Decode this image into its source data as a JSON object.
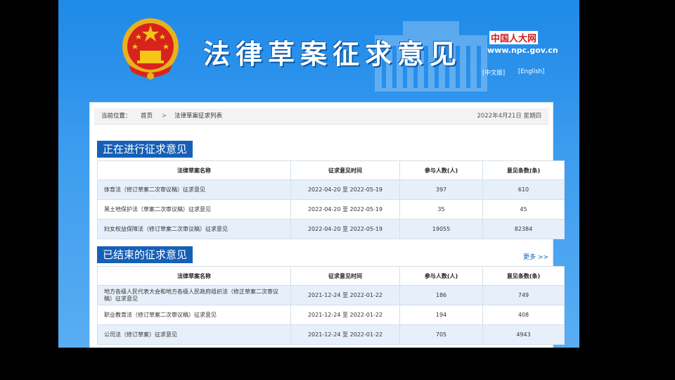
{
  "header": {
    "title": "法律草案征求意见",
    "logo_text": "中国人大网",
    "url": "www.npc.gov.cn",
    "lang_cn": "[中文版]",
    "lang_en": "[English]"
  },
  "breadcrumb": {
    "label": "当前位置：",
    "home": "首页",
    "separator": ">",
    "current": "法律草案征求列表",
    "date": "2022年4月21日 星期四"
  },
  "ongoing": {
    "title": "正在进行征求意见",
    "columns": [
      "法律草案名称",
      "征求意见时间",
      "参与人数(人)",
      "意见条数(条)"
    ],
    "rows": [
      {
        "name": "体育法（修订草案二次审议稿）征求意见",
        "time": "2022-04-20 至 2022-05-19",
        "people": "397",
        "opinions": "610"
      },
      {
        "name": "黑土地保护法（草案二次审议稿）征求意见",
        "time": "2022-04-20 至 2022-05-19",
        "people": "35",
        "opinions": "45"
      },
      {
        "name": "妇女权益保障法（修订草案二次审议稿）征求意见",
        "time": "2022-04-20 至 2022-05-19",
        "people": "19055",
        "opinions": "82384"
      }
    ]
  },
  "finished": {
    "title": "已结束的征求意见",
    "more": "更多 >>",
    "columns": [
      "法律草案名称",
      "征求意见时间",
      "参与人数(人)",
      "意见条数(条)"
    ],
    "rows": [
      {
        "name": "地方各级人民代表大会和地方各级人民政府组织法（修正草案二次审议稿）征求意见",
        "time": "2021-12-24 至 2022-01-22",
        "people": "186",
        "opinions": "749"
      },
      {
        "name": "职业教育法（修订草案二次审议稿）征求意见",
        "time": "2021-12-24 至 2022-01-22",
        "people": "194",
        "opinions": "408"
      },
      {
        "name": "公司法（修订草案）征求意见",
        "time": "2021-12-24 至 2022-01-22",
        "people": "705",
        "opinions": "4943"
      }
    ]
  },
  "colors": {
    "header_blue": "#1f8ae8",
    "section_blue": "#1560b6",
    "row_stripe": "#e7f0fa",
    "logo_red": "#d21a1a"
  }
}
